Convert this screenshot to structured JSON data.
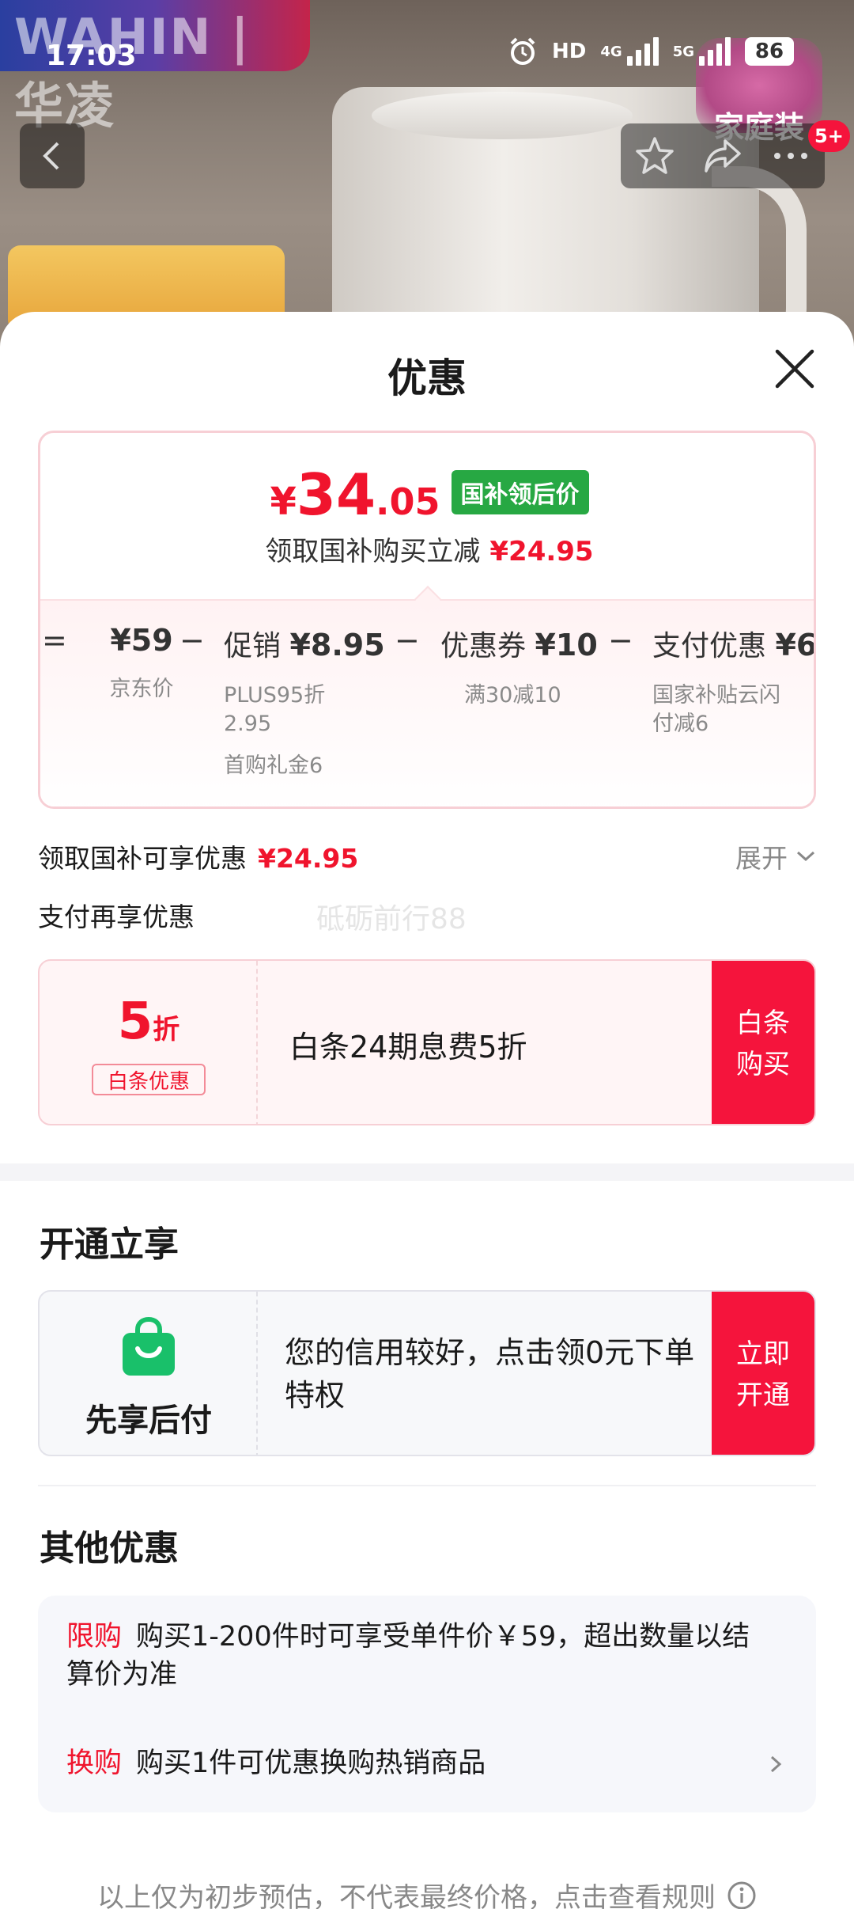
{
  "status_bar": {
    "time": "17:03",
    "network_hd": "HD",
    "net_4g": "4G",
    "net_5g": "5G",
    "battery": "86"
  },
  "brand": {
    "logo_text": "WAHIN | 华凌"
  },
  "product_banner": {
    "badge_text": "家庭装"
  },
  "nav": {
    "cart_count": "5+"
  },
  "sheet": {
    "title": "优惠",
    "final": {
      "yen": "¥",
      "int": "34",
      "dec": ".05",
      "tag": "国补领后价",
      "sub_text": "领取国补购买立减",
      "sub_amount": "¥24.95"
    },
    "breakdown": {
      "op_equal": "=",
      "op_minus": "−",
      "items": [
        {
          "label": "",
          "amount": "¥59",
          "sub": "京东价",
          "sub2": ""
        },
        {
          "label": "促销",
          "amount": "¥8.95",
          "sub": "PLUS95折\n2.95",
          "sub2": "首购礼金6"
        },
        {
          "label": "优惠券",
          "amount": "¥10",
          "sub": "满30减10",
          "sub2": ""
        },
        {
          "label": "支付优惠",
          "amount": "¥6",
          "sub": "国家补贴云闪\n付减6",
          "sub2": ""
        }
      ]
    },
    "subsidy_row": {
      "label": "领取国补可享优惠",
      "amount": "¥24.95",
      "expand": "展开"
    },
    "pay_row": {
      "label": "支付再享优惠"
    },
    "watermark": "砥砺前行88",
    "baitiao": {
      "discount_num": "5",
      "discount_unit": "折",
      "tag": "白条优惠",
      "desc": "白条24期息费5折",
      "button": "白条\n购买"
    },
    "open_section": {
      "title": "开通立享",
      "name": "先享后付",
      "desc": "您的信用较好，点击领0元下单特权",
      "button": "立即\n开通"
    },
    "other_section": {
      "title": "其他优惠",
      "promos": [
        {
          "tag": "限购",
          "text": "购买1-200件时可享受单件价￥59，超出数量以结算价为准"
        },
        {
          "tag": "换购",
          "text": "购买1件可优惠换购热销商品"
        }
      ]
    },
    "footer": "以上仅为初步预估，不代表最终价格，点击查看规则"
  },
  "colors": {
    "accent_red": "#f0142d",
    "button_red": "#f5143c",
    "tag_green": "#27a843"
  }
}
